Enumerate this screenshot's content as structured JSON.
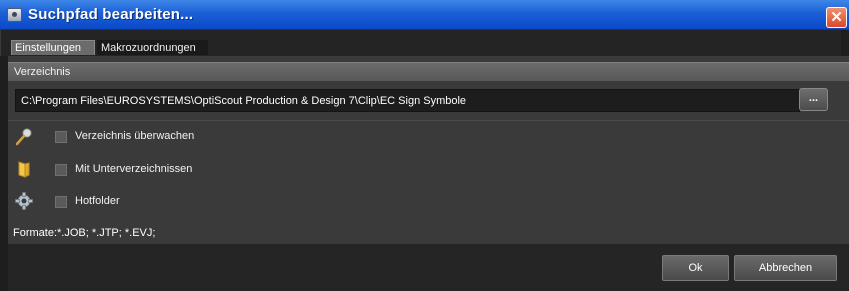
{
  "window": {
    "title": "Suchpfad bearbeiten...",
    "close_symbol": "✕"
  },
  "tabs": [
    {
      "label": "Einstellungen",
      "active": true
    },
    {
      "label": "Makrozuordnungen",
      "active": false
    }
  ],
  "directory": {
    "section_label": "Verzeichnis",
    "path": "C:\\Program Files\\EUROSYSTEMS\\OptiScout Production & Design 7\\Clip\\EC Sign Symbole",
    "browse_label": "..."
  },
  "options": [
    {
      "label": "Verzeichnis überwachen",
      "icon": "microphone-icon",
      "checked": false
    },
    {
      "label": "Mit Unterverzeichnissen",
      "icon": "folder-icon",
      "checked": false
    },
    {
      "label": "Hotfolder",
      "icon": "gear-icon",
      "checked": false
    }
  ],
  "formats": "Formate:*.JOB; *.JTP; *.EVJ;",
  "footer": {
    "ok_label": "Ok",
    "cancel_label": "Abbrechen"
  },
  "colors": {
    "titlebar": "#1c5fd6",
    "panel": "#3a3a3a",
    "close": "#d9482a"
  }
}
